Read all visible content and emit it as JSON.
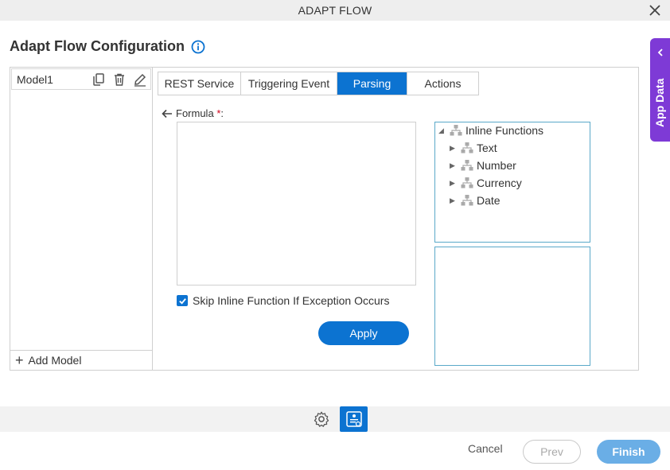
{
  "window": {
    "title": "ADAPT FLOW",
    "close_icon": "close-icon"
  },
  "page": {
    "title": "Adapt Flow Configuration",
    "info_icon": "info-icon"
  },
  "app_data_tab": {
    "label": "App Data",
    "icon": "chevron-left-icon",
    "color": "#7e3ad6"
  },
  "left_panel": {
    "model_name": "Model1",
    "model_actions": [
      "copy-icon",
      "delete-icon",
      "edit-icon"
    ],
    "add_label": "Add Model"
  },
  "tabs": [
    {
      "label": "REST Service",
      "active": false
    },
    {
      "label": "Triggering Event",
      "active": false
    },
    {
      "label": "Parsing",
      "active": true
    },
    {
      "label": "Actions",
      "active": false
    }
  ],
  "formula": {
    "label": "Formula",
    "required_marker": "*",
    "colon": ":",
    "value": ""
  },
  "skip_option": {
    "label": "Skip Inline Function If Exception Occurs",
    "checked": true
  },
  "apply_label": "Apply",
  "function_tree": {
    "root": "Inline Functions",
    "children": [
      "Text",
      "Number",
      "Currency",
      "Date"
    ]
  },
  "footer": {
    "gear_icon": "gear-icon",
    "app_icon": "app-data-icon",
    "cancel_label": "Cancel",
    "prev_label": "Prev",
    "finish_label": "Finish"
  },
  "colors": {
    "primary": "#0c73d1",
    "accent": "#7e3ad6",
    "finish_disabled": "#6aaee6"
  }
}
